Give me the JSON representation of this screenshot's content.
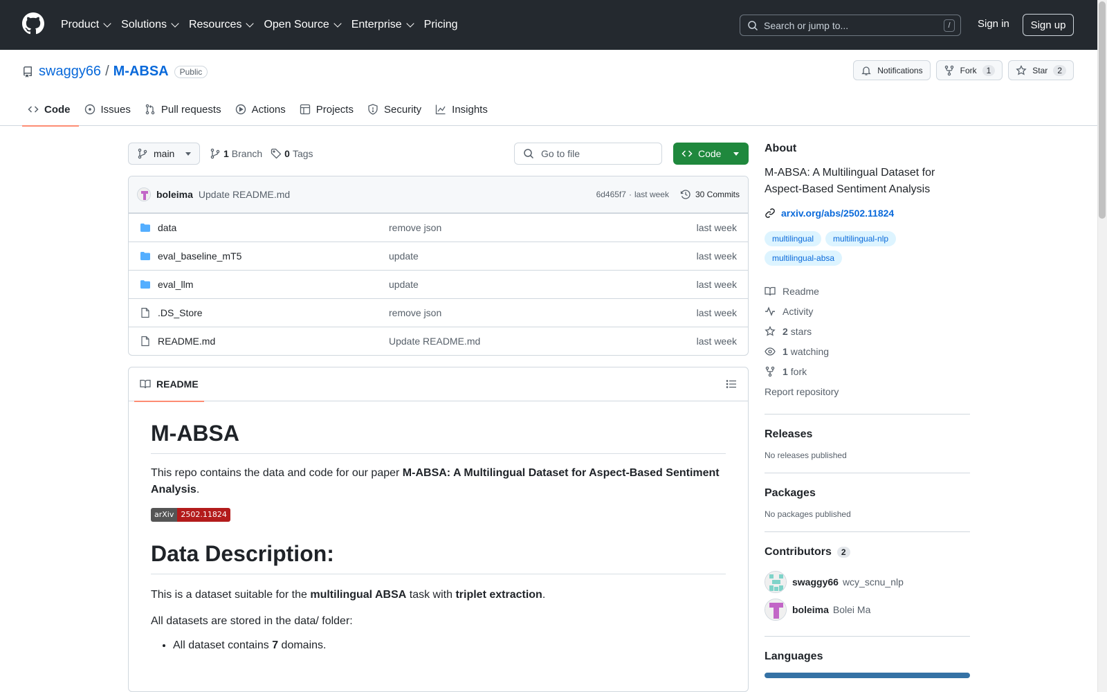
{
  "header": {
    "nav": [
      "Product",
      "Solutions",
      "Resources",
      "Open Source",
      "Enterprise",
      "Pricing"
    ],
    "search_placeholder": "Search or jump to...",
    "slash_key": "/",
    "signin": "Sign in",
    "signup": "Sign up"
  },
  "repo": {
    "owner": "swaggy66",
    "sep": "/",
    "name": "M-ABSA",
    "visibility": "Public",
    "notifications": "Notifications",
    "fork_label": "Fork",
    "fork_count": "1",
    "star_label": "Star",
    "star_count": "2"
  },
  "tabs": [
    "Code",
    "Issues",
    "Pull requests",
    "Actions",
    "Projects",
    "Security",
    "Insights"
  ],
  "toolbar": {
    "branch": "main",
    "branches_count": "1",
    "branches_label": "Branch",
    "tags_count": "0",
    "tags_label": "Tags",
    "goto_file": "Go to file",
    "code_button": "Code"
  },
  "commit": {
    "author": "boleima",
    "message": "Update README.md",
    "hash": "6d465f7",
    "sep": "·",
    "when": "last week",
    "commits": "30 Commits"
  },
  "files": [
    {
      "name": "data",
      "type": "folder",
      "message": "remove json",
      "time": "last week"
    },
    {
      "name": "eval_baseline_mT5",
      "type": "folder",
      "message": "update",
      "time": "last week"
    },
    {
      "name": "eval_llm",
      "type": "folder",
      "message": "update",
      "time": "last week"
    },
    {
      "name": ".DS_Store",
      "type": "file",
      "message": "remove json",
      "time": "last week"
    },
    {
      "name": "README.md",
      "type": "file",
      "message": "Update README.md",
      "time": "last week"
    }
  ],
  "readme": {
    "tab": "README",
    "h1": "M-ABSA",
    "p1_pre": "This repo contains the data and code for our paper ",
    "p1_bold": "M-ABSA: A Multilingual Dataset for Aspect-Based Sentiment Analysis",
    "p1_post": ".",
    "badge_left": "arXiv",
    "badge_right": "2502.11824",
    "h2": "Data Description:",
    "p2_pre": "This is a dataset suitable for the ",
    "p2_b1": "multilingual ABSA",
    "p2_mid": " task with ",
    "p2_b2": "triplet extraction",
    "p2_post": ".",
    "p3": "All datasets are stored in the data/ folder:",
    "li_pre": "All dataset contains ",
    "li_bold": "7",
    "li_post": " domains."
  },
  "about": {
    "title": "About",
    "description": "M-ABSA: A Multilingual Dataset for Aspect-Based Sentiment Analysis",
    "link": "arxiv.org/abs/2502.11824",
    "topics": [
      "multilingual",
      "multilingual-nlp",
      "multilingual-absa"
    ],
    "readme": "Readme",
    "activity": "Activity",
    "stars_n": "2",
    "stars": "stars",
    "watching_n": "1",
    "watching": "watching",
    "fork_n": "1",
    "fork": "fork",
    "report": "Report repository"
  },
  "releases": {
    "title": "Releases",
    "text": "No releases published"
  },
  "packages": {
    "title": "Packages",
    "text": "No packages published"
  },
  "contributors": {
    "title": "Contributors",
    "count": "2",
    "list": [
      {
        "login": "swaggy66",
        "name": "wcy_scnu_nlp"
      },
      {
        "login": "boleima",
        "name": "Bolei Ma"
      }
    ]
  },
  "languages": {
    "title": "Languages"
  },
  "colors": {
    "accent": "#0969da",
    "green": "#1f883d",
    "header": "#24292f",
    "underline": "#fd8c73"
  }
}
